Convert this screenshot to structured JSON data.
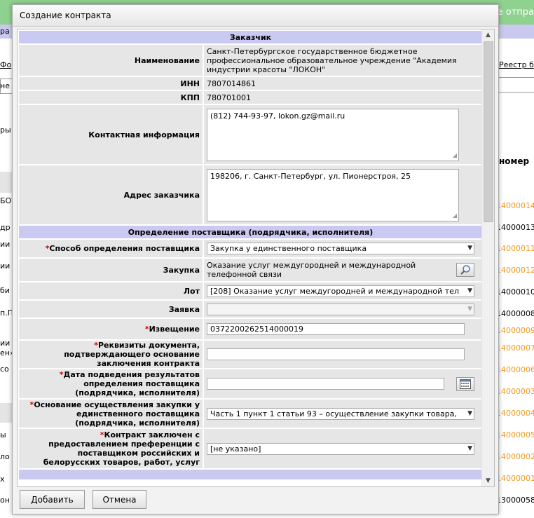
{
  "background": {
    "top_right_text": "е отпра",
    "band_text": "ра",
    "links": [
      "Фо",
      "Реестр б"
    ],
    "left_fragments": [
      "не",
      "ры",
      "БОУ",
      "др",
      "ии",
      "ии",
      "би",
      "п.П",
      "ии",
      "ен»",
      "со",
      "ы",
      "ло",
      "х",
      "он"
    ],
    "column_header": "номер",
    "numbers": [
      {
        "text": "14000014",
        "orange": true
      },
      {
        "text": "14000013",
        "orange": false
      },
      {
        "text": "14000011",
        "orange": true
      },
      {
        "text": "14000012",
        "orange": true
      },
      {
        "text": "14000010",
        "orange": false
      },
      {
        "text": "14000008",
        "orange": false
      },
      {
        "text": "14000009",
        "orange": true
      },
      {
        "text": "14000007",
        "orange": true
      },
      {
        "text": "14000006",
        "orange": true
      },
      {
        "text": "14000003",
        "orange": true
      },
      {
        "text": "14000004",
        "orange": true
      },
      {
        "text": "14000005",
        "orange": true
      },
      {
        "text": "14000002",
        "orange": true
      },
      {
        "text": "14000001",
        "orange": true
      },
      {
        "text": "13000058",
        "orange": false
      }
    ]
  },
  "dialog": {
    "title": "Создание контракта",
    "customer_section": "Заказчик",
    "name_label": "Наименование",
    "name_value": "Санкт-Петербургское государственное бюджетное профессиональное образовательное учреждение \"Академия индустрии красоты \"ЛОКОН\"",
    "inn_label": "ИНН",
    "inn_value": "7807014861",
    "kpp_label": "КПП",
    "kpp_value": "780701001",
    "contact_label": "Контактная информация",
    "contact_value": "(812) 744-93-97, lokon.gz@mail.ru",
    "address_label": "Адрес заказчика",
    "address_value": "198206, г. Санкт-Петербург, ул. Пионерстроя, 25",
    "supplier_section": "Определение поставщика (подрядчика, исполнителя)",
    "method_label": "Способ определения поставщика",
    "method_value": "Закупка у единственного поставщика",
    "purchase_label": "Закупка",
    "purchase_value": "Оказание услуг междугородней и международной телефонной связи",
    "lot_label": "Лот",
    "lot_value": "[208] Оказание услуг междугородней и международной тел",
    "bid_label": "Заявка",
    "bid_value": "",
    "notice_label": "Извещение",
    "notice_value": "0372200262514000019",
    "doc_label": "Реквизиты документа, подтверждающего основание заключения контракта",
    "doc_value": "",
    "date_label": "Дата подведения результатов определения поставщика (подрядчика, исполнителя)",
    "date_value": "",
    "basis_label": "Основание осуществления закупки у единственного поставщика (подрядчика, исполнителя)",
    "basis_value": "Часть 1 пункт 1 статьи 93 – осуществление закупки товара,",
    "preference_label": "Контракт заключен с предоставлением преференции с поставщиком российских и белорусских товаров, работ, услуг",
    "preference_value": "[не указано]",
    "add_button": "Добавить",
    "cancel_button": "Отмена"
  },
  "colors": {
    "section_header": "#c9c9f2",
    "label_cell": "#e6e6e6",
    "required_star": "#d40000",
    "bg_topbar": "#8fd18f",
    "bg_number_orange": "#f09a20"
  },
  "icons": [
    "search-icon",
    "calendar-icon",
    "chevron-down-icon",
    "resize-grip-icon",
    "scroll-up-icon",
    "scroll-down-icon"
  ]
}
